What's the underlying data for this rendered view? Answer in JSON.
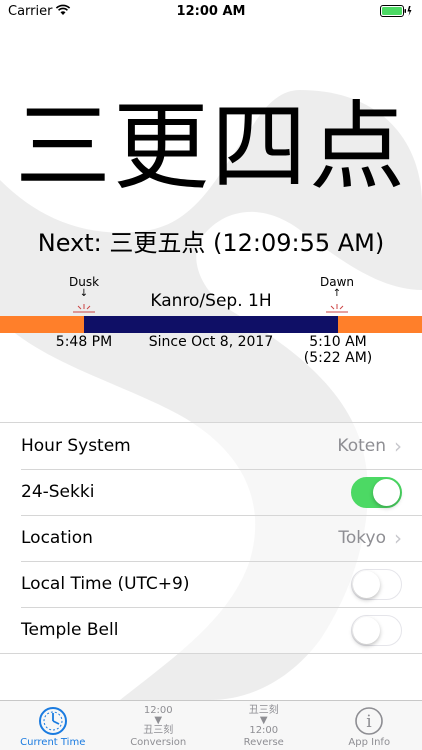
{
  "status_bar": {
    "carrier": "Carrier",
    "time": "12:00 AM"
  },
  "main": {
    "current_hour": "三更四点",
    "next_label": "Next: 三更五点 (12:09:55 AM)"
  },
  "day_bar": {
    "dusk_label": "Dusk",
    "dawn_label": "Dawn",
    "sekki": "Kanro/Sep. 1H",
    "left_time": "5:48 PM",
    "since": "Since Oct 8, 2017",
    "right_time": "5:10 AM",
    "right_time_alt": "(5:22 AM)",
    "day_color": "#ff7f2a",
    "night_color": "#0f0f66"
  },
  "settings": {
    "hour_system": {
      "label": "Hour System",
      "value": "Koten"
    },
    "sekki_24": {
      "label": "24-Sekki",
      "on": true
    },
    "location": {
      "label": "Location",
      "value": "Tokyo"
    },
    "local_time": {
      "label": "Local Time (UTC+9)",
      "on": false
    },
    "temple_bell": {
      "label": "Temple Bell",
      "on": false
    }
  },
  "tab_bar": {
    "tabs": [
      {
        "label": "Current Time",
        "icon": "clock-icon",
        "active": true
      },
      {
        "label": "Conversion",
        "icon": "conversion-icon",
        "active": false,
        "top": "12:00",
        "bottom": "丑三刻"
      },
      {
        "label": "Reverse",
        "icon": "reverse-icon",
        "active": false,
        "top": "丑三刻",
        "bottom": "12:00"
      },
      {
        "label": "App Info",
        "icon": "info-icon",
        "active": false,
        "glyph": "i"
      }
    ]
  },
  "colors": {
    "accent": "#1a7be0",
    "toggle_on": "#4cd964"
  }
}
